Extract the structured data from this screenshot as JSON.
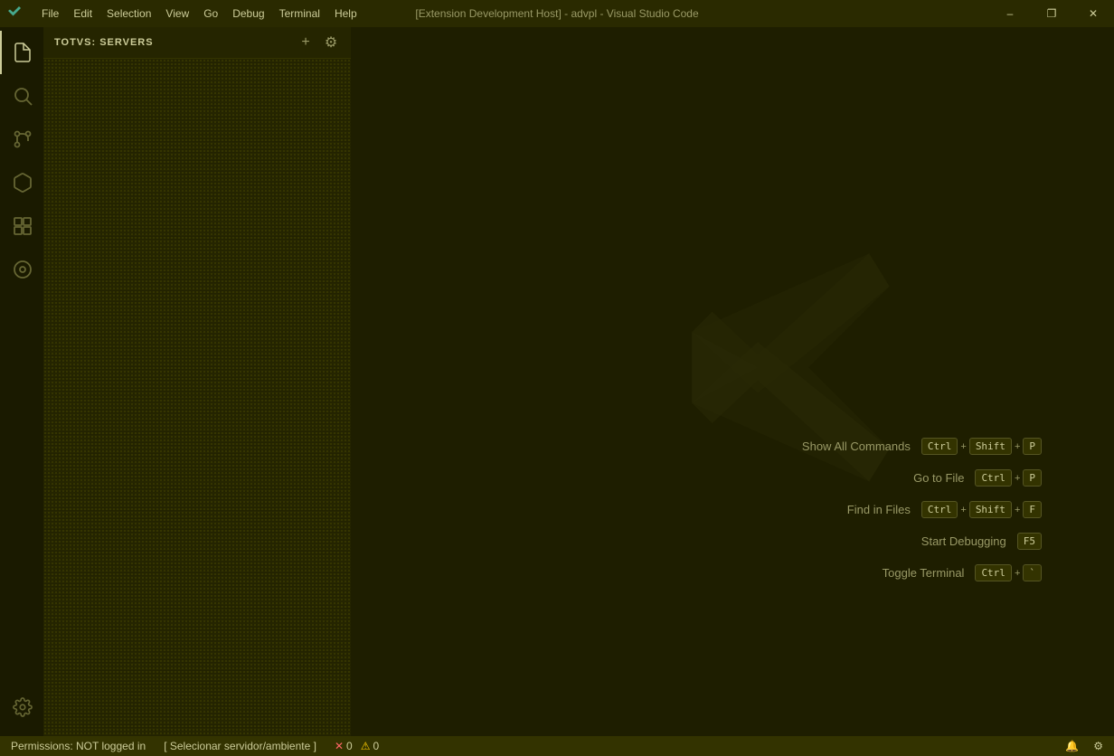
{
  "titlebar": {
    "title": "[Extension Development Host] - advpl - Visual Studio Code",
    "menu": [
      "File",
      "Edit",
      "Selection",
      "View",
      "Go",
      "Debug",
      "Terminal",
      "Help"
    ],
    "controls": {
      "minimize": "–",
      "maximize": "❐",
      "close": "✕"
    }
  },
  "sidebar": {
    "title": "TOTVS: SERVERS",
    "add_label": "+",
    "settings_label": "⚙"
  },
  "shortcuts": [
    {
      "label": "Show All Commands",
      "keys": [
        "Ctrl",
        "+",
        "Shift",
        "+",
        "P"
      ]
    },
    {
      "label": "Go to File",
      "keys": [
        "Ctrl",
        "+",
        "P"
      ]
    },
    {
      "label": "Find in Files",
      "keys": [
        "Ctrl",
        "+",
        "Shift",
        "+",
        "F"
      ]
    },
    {
      "label": "Start Debugging",
      "keys": [
        "F5"
      ]
    },
    {
      "label": "Toggle Terminal",
      "keys": [
        "Ctrl",
        "+",
        "`"
      ]
    }
  ],
  "statusbar": {
    "permissions": "Permissions: NOT logged in",
    "server": "[ Selecionar servidor/ambiente ]",
    "errors": "0",
    "warnings": "0",
    "notifications_icon": "🔔",
    "settings_icon": "⚙"
  },
  "icons": {
    "explorer": "📄",
    "search": "🔍",
    "source_control": "⎇",
    "extensions": "⚙",
    "remote": "⊞",
    "custom": "⊙"
  }
}
